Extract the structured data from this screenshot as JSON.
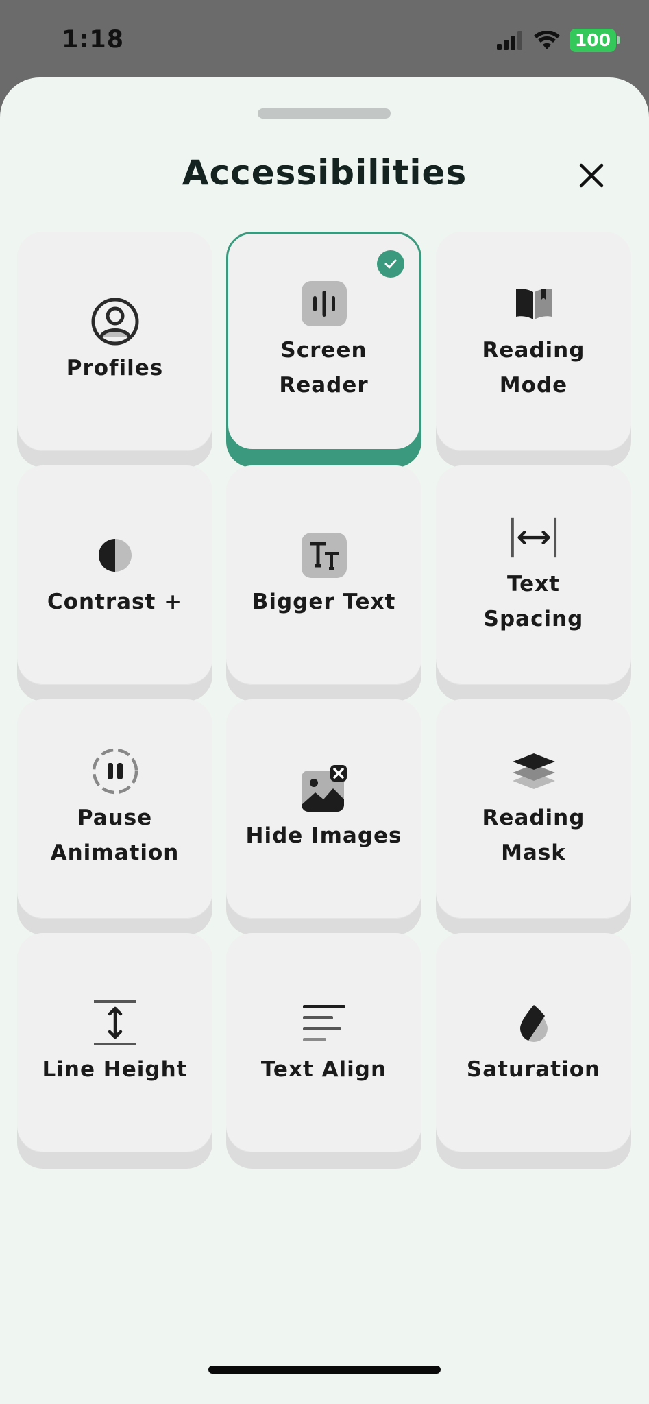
{
  "status_bar": {
    "time": "1:18",
    "battery": "100"
  },
  "sheet": {
    "title": "Accessibilities"
  },
  "tiles": [
    {
      "label": "Profiles",
      "icon": "profile-icon",
      "active": false
    },
    {
      "label": "Screen\nReader",
      "icon": "screen-reader-icon",
      "active": true
    },
    {
      "label": "Reading\nMode",
      "icon": "book-icon",
      "active": false
    },
    {
      "label": "Contrast +",
      "icon": "contrast-icon",
      "active": false
    },
    {
      "label": "Bigger Text",
      "icon": "text-size-icon",
      "active": false
    },
    {
      "label": "Text\nSpacing",
      "icon": "text-spacing-icon",
      "active": false
    },
    {
      "label": "Pause\nAnimation",
      "icon": "pause-icon",
      "active": false
    },
    {
      "label": "Hide Images",
      "icon": "hide-image-icon",
      "active": false
    },
    {
      "label": "Reading\nMask",
      "icon": "layers-icon",
      "active": false
    },
    {
      "label": "Line Height",
      "icon": "line-height-icon",
      "active": false
    },
    {
      "label": "Text Align",
      "icon": "text-align-icon",
      "active": false
    },
    {
      "label": "Saturation",
      "icon": "saturation-drop-icon",
      "active": false
    }
  ],
  "colors": {
    "accent": "#3b9a7e",
    "tile": "#f0f0f0",
    "sheet": "#eff5f1",
    "status_bg": "#6b6b6b"
  }
}
